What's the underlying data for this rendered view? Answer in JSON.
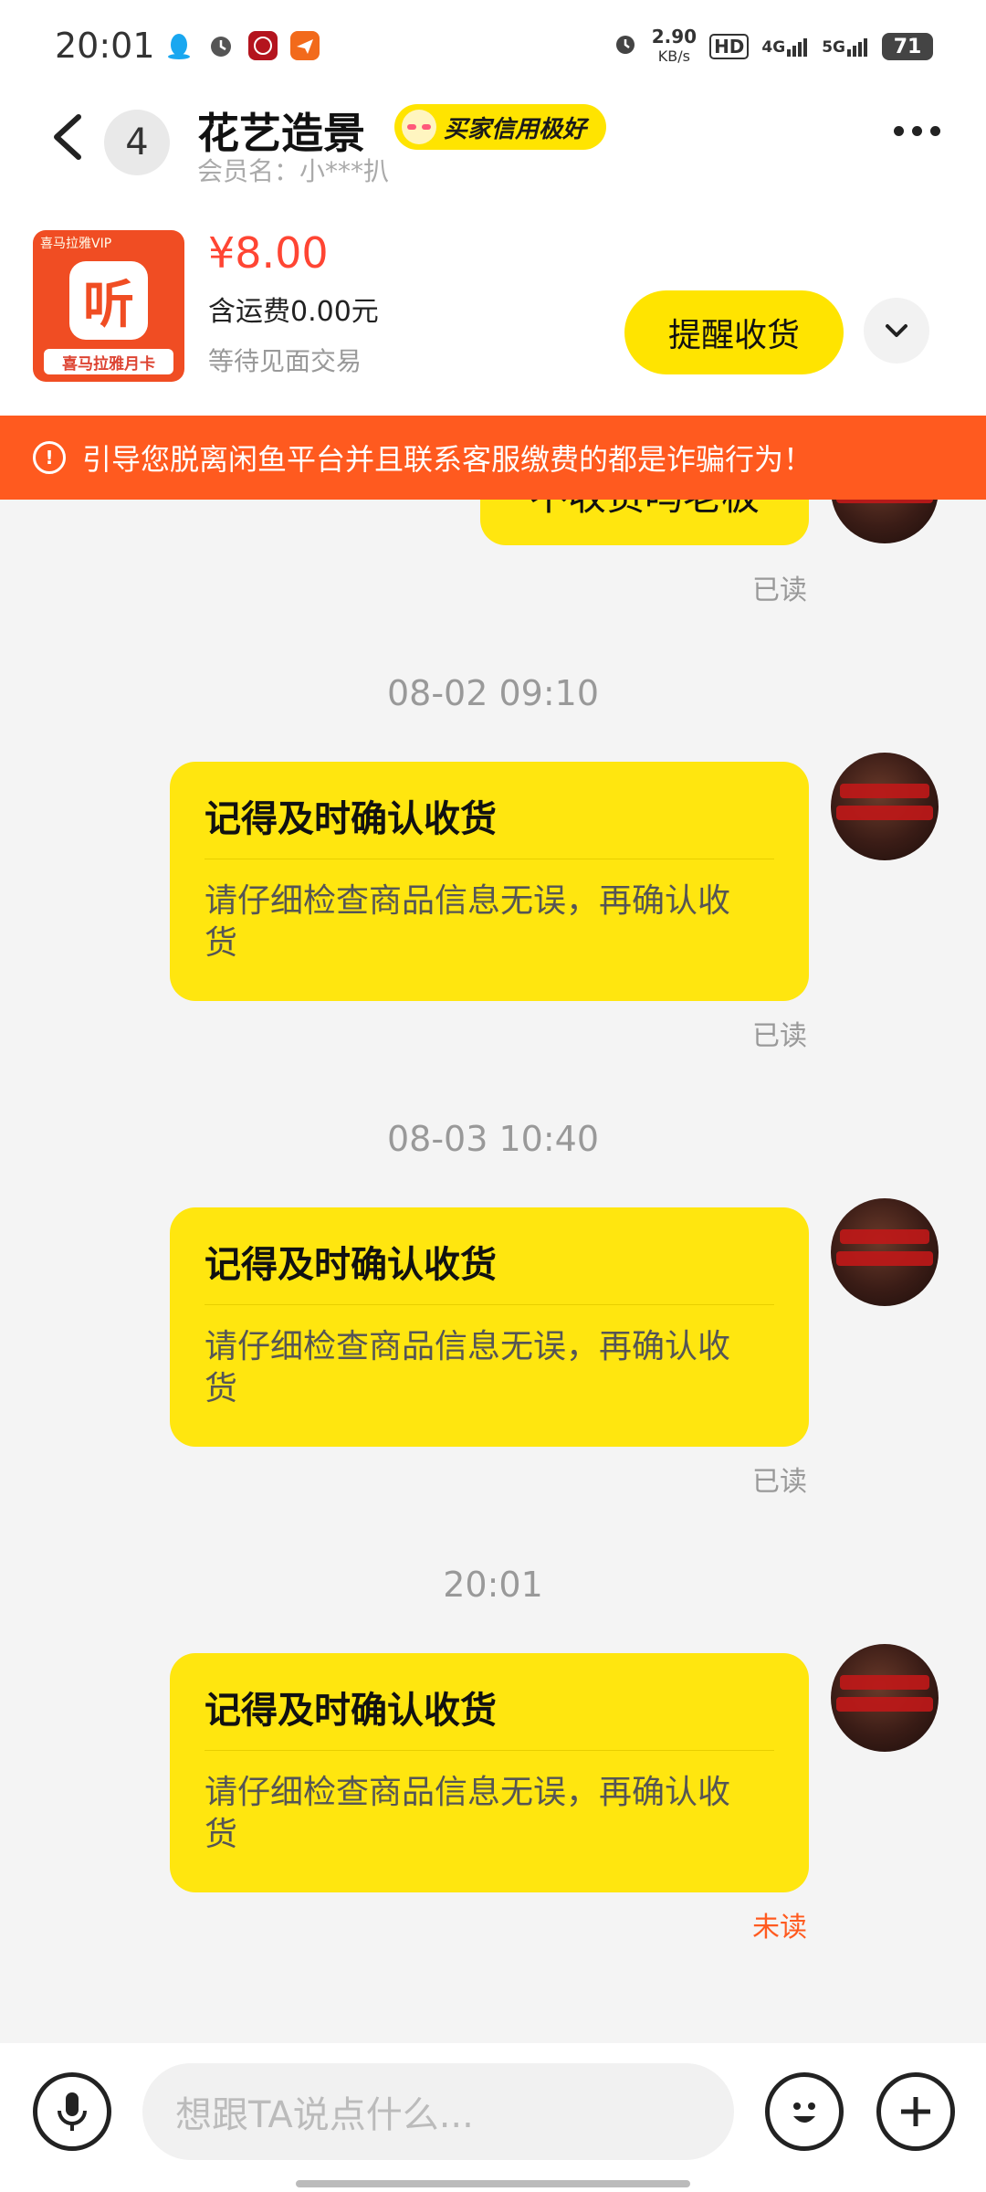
{
  "status_bar": {
    "time": "20:01",
    "net_speed_value": "2.90",
    "net_speed_unit": "KB/s",
    "hd": "HD",
    "sig1": "4G",
    "sig2": "5G",
    "battery": "71"
  },
  "header": {
    "unread_count": "4",
    "title": "花艺造景",
    "credit_badge": "买家信用极好",
    "member": "会员名：小***扒"
  },
  "product": {
    "thumb_vip": "喜马拉雅VIP",
    "thumb_logo": "听",
    "thumb_caption": "喜马拉雅月卡",
    "price": "¥8.00",
    "shipping": "含运费0.00元",
    "status": "等待见面交易",
    "remind_button": "提醒收货"
  },
  "warning": {
    "text": "引导您脱离闲鱼平台并且联系客服缴费的都是诈骗行为！"
  },
  "chat": {
    "partial_message": "不收货吗老板",
    "partial_read": "已读",
    "groups": [
      {
        "timestamp": "08-02 09:10",
        "title": "记得及时确认收货",
        "body": "请仔细检查商品信息无误，再确认收货",
        "read": "已读"
      },
      {
        "timestamp": "08-03 10:40",
        "title": "记得及时确认收货",
        "body": "请仔细检查商品信息无误，再确认收货",
        "read": "已读"
      },
      {
        "timestamp": "20:01",
        "title": "记得及时确认收货",
        "body": "请仔细检查商品信息无误，再确认收货",
        "read": "未读"
      }
    ]
  },
  "input": {
    "placeholder": "想跟TA说点什么..."
  },
  "colors": {
    "accent_yellow": "#ffe60f",
    "warning_orange": "#ff5a1f",
    "price_red": "#ff4533"
  }
}
